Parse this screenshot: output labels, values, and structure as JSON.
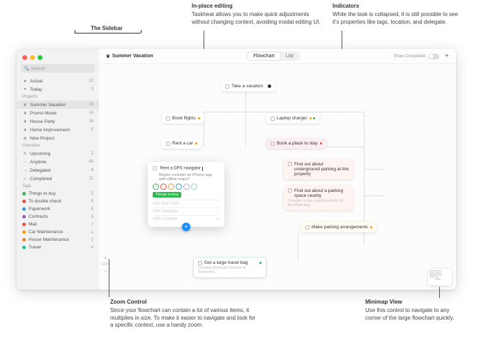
{
  "callouts": {
    "sidebar": {
      "title": "The Sidebar"
    },
    "inplace": {
      "title": "In-place editing",
      "desc": "Taskheat allows you to make quick adjustments without changing context, avoiding modal editing UI."
    },
    "indicators": {
      "title": "Indicators",
      "desc": "While the task is collapsed, it is still possible to see it's properties like tags, location, and delegate."
    },
    "zoom": {
      "title": "Zoom Control",
      "desc": "Since your flowchart can contain a lot of various items, it multiplies in size. To make it easier to navigate and look for a specific context, use a handy zoom."
    },
    "minimap": {
      "title": "Minimap View",
      "desc": "Use this control to navigate to any corner of the large flowchart quickly."
    }
  },
  "sidebar": {
    "search_placeholder": "Search",
    "smart": [
      {
        "icon": "★",
        "label": "Actual",
        "count": 12
      },
      {
        "icon": "●",
        "label": "Today",
        "count": 3
      }
    ],
    "projects_label": "Projects",
    "projects": [
      {
        "icon": "❦",
        "label": "Summer Vacation",
        "count": 19,
        "selected": true
      },
      {
        "icon": "❦",
        "label": "Promo Movie",
        "count": 14
      },
      {
        "icon": "❦",
        "label": "House Party",
        "count": 16
      },
      {
        "icon": "❦",
        "label": "Home Improvement",
        "count": 5
      }
    ],
    "new_project_label": "New Project",
    "overview_label": "Overview",
    "overview": [
      {
        "icon": "↻",
        "label": "Upcoming",
        "count": 2
      },
      {
        "icon": "⋯",
        "label": "Anytime",
        "count": 49
      },
      {
        "icon": "→",
        "label": "Delegated",
        "count": 8
      },
      {
        "icon": "✓",
        "label": "Completed",
        "count": 11
      }
    ],
    "tags_label": "Tags",
    "tags": [
      {
        "color": "#2db84d",
        "label": "Things to buy",
        "count": 5
      },
      {
        "color": "#e74c3c",
        "label": "To double check",
        "count": 5
      },
      {
        "color": "#3498db",
        "label": "Paperwork",
        "count": 5
      },
      {
        "color": "#9b59b6",
        "label": "Contracts",
        "count": 5
      },
      {
        "color": "#e74c3c",
        "label": "Mail",
        "count": 7
      },
      {
        "color": "#f39c12",
        "label": "Car Maintenance",
        "count": 1
      },
      {
        "color": "#e67e22",
        "label": "House Maintenance",
        "count": 2
      },
      {
        "color": "#1abc9c",
        "label": "Travel",
        "count": 4
      }
    ]
  },
  "toolbar": {
    "project_icon": "❦",
    "title": "Summer Vacation",
    "seg_flowchart": "Flowchart",
    "seg_list": "List",
    "show_completed": "Show Completed",
    "plus": "+"
  },
  "nodes": {
    "root": "Take a vacation",
    "book_flights": "Book flights",
    "laptop_charger": "Laptop charger",
    "rent_car": "Rent a car",
    "book_place": "Book a place to stay",
    "underground": {
      "t": "Find out about underground parking at the property"
    },
    "parking_space": {
      "t": "Find out about a parking space nearby",
      "s": "Consider to buy a parking tickets for the whole stay."
    },
    "make_parking": "Make parking arrangements",
    "travel_bag": {
      "t": "Get a large travel bag",
      "s": "Consider American Tourister or Samsonite."
    }
  },
  "popover": {
    "title": "Rent a GPS navigator",
    "subtitle": "Maybe consider an iPhone app with offline maps?",
    "tag_colors": [
      "#2db84d",
      "#e74c3c",
      "#f39c12",
      "#3498db",
      "#c49bd6",
      "#8fd4a8"
    ],
    "pill": "Things to buy",
    "field_due": "Add Due Date",
    "field_delegate": "Add Delegate",
    "field_location": "Add Location"
  },
  "zoom": {
    "plus": "+",
    "label": "100%",
    "minus": "−"
  }
}
